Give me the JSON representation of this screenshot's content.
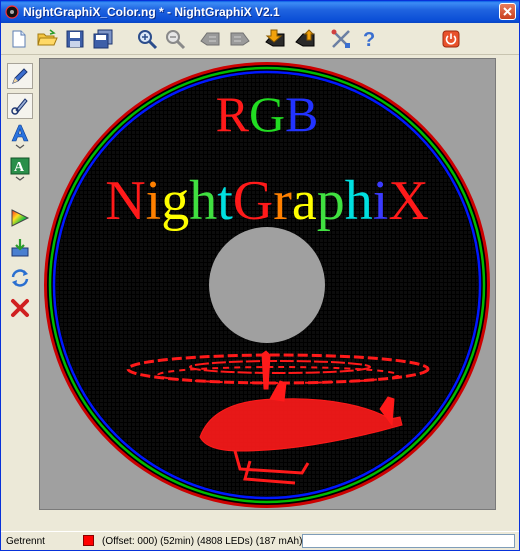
{
  "window": {
    "title": "NightGraphiX_Color.ng * - NightGraphiX V2.1"
  },
  "toolbar": {
    "buttons": [
      {
        "icon": "new-file-icon"
      },
      {
        "icon": "open-folder-icon"
      },
      {
        "icon": "save-icon"
      },
      {
        "icon": "save-as-icon"
      },
      {
        "icon": "zoom-in-icon"
      },
      {
        "icon": "zoom-out-icon"
      },
      {
        "icon": "rotate-left-icon"
      },
      {
        "icon": "rotate-right-icon"
      },
      {
        "icon": "upload-to-device-icon"
      },
      {
        "icon": "download-from-device-icon"
      },
      {
        "icon": "settings-tools-icon"
      },
      {
        "icon": "help-icon"
      },
      {
        "icon": "power-off-icon"
      }
    ]
  },
  "sidebar": {
    "tools": [
      {
        "icon": "pencil-icon"
      },
      {
        "icon": "brush-icon"
      },
      {
        "icon": "text-tool-icon"
      },
      {
        "icon": "font-tool-icon"
      },
      {
        "icon": "gradient-icon"
      },
      {
        "icon": "import-image-icon"
      },
      {
        "icon": "refresh-icon"
      },
      {
        "icon": "delete-icon"
      }
    ]
  },
  "canvas": {
    "heading": "RGB",
    "heading_letters": [
      {
        "ch": "R",
        "color": "#ff1a1a"
      },
      {
        "ch": "G",
        "color": "#22dd22"
      },
      {
        "ch": "B",
        "color": "#2233ff"
      }
    ],
    "title_letters": [
      {
        "ch": "N",
        "color": "#ff1a1a"
      },
      {
        "ch": "i",
        "color": "#ff8000"
      },
      {
        "ch": "g",
        "color": "#ffff00"
      },
      {
        "ch": "h",
        "color": "#40e040"
      },
      {
        "ch": "t",
        "color": "#00e0e0"
      },
      {
        "ch": "G",
        "color": "#ff1a1a"
      },
      {
        "ch": "r",
        "color": "#ff8000"
      },
      {
        "ch": "a",
        "color": "#ffff00"
      },
      {
        "ch": "p",
        "color": "#40e040"
      },
      {
        "ch": "h",
        "color": "#00e0e0"
      },
      {
        "ch": "i",
        "color": "#3a3aff"
      },
      {
        "ch": "X",
        "color": "#ff1a1a"
      }
    ],
    "ring_colors": [
      "#ff0000",
      "#00cc00",
      "#0000ff"
    ],
    "artwork_icon": "helicopter-graphic"
  },
  "status": {
    "connection": "Getrennt",
    "color": "#ff0000",
    "info": "(Offset: 000)  (52min)  (4808 LEDs)  (187 mAh)"
  }
}
